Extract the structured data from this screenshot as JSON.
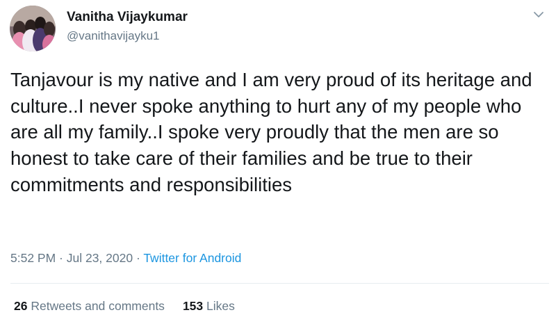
{
  "tweet": {
    "author": {
      "display_name": "Vanitha Vijaykumar",
      "handle": "@vanithavijayku1"
    },
    "text": "Tanjavour is my native and I am very proud of its heritage and culture..I never spoke anything to hurt any of my people who are all my family..I spoke very proudly that the men are so honest to take care of their families and be true to their commitments and responsibilities",
    "timestamp": "5:52 PM · Jul 23, 2020",
    "separator": " · ",
    "source": "Twitter for Android",
    "stats": {
      "retweets_count": "26",
      "retweets_label": "Retweets and comments",
      "likes_count": "153",
      "likes_label": "Likes"
    },
    "menu_icon": "chevron-down-icon"
  },
  "colors": {
    "text_primary": "#14171a",
    "text_secondary": "#657786",
    "link": "#1b95e0",
    "divider": "#e6ecf0"
  }
}
